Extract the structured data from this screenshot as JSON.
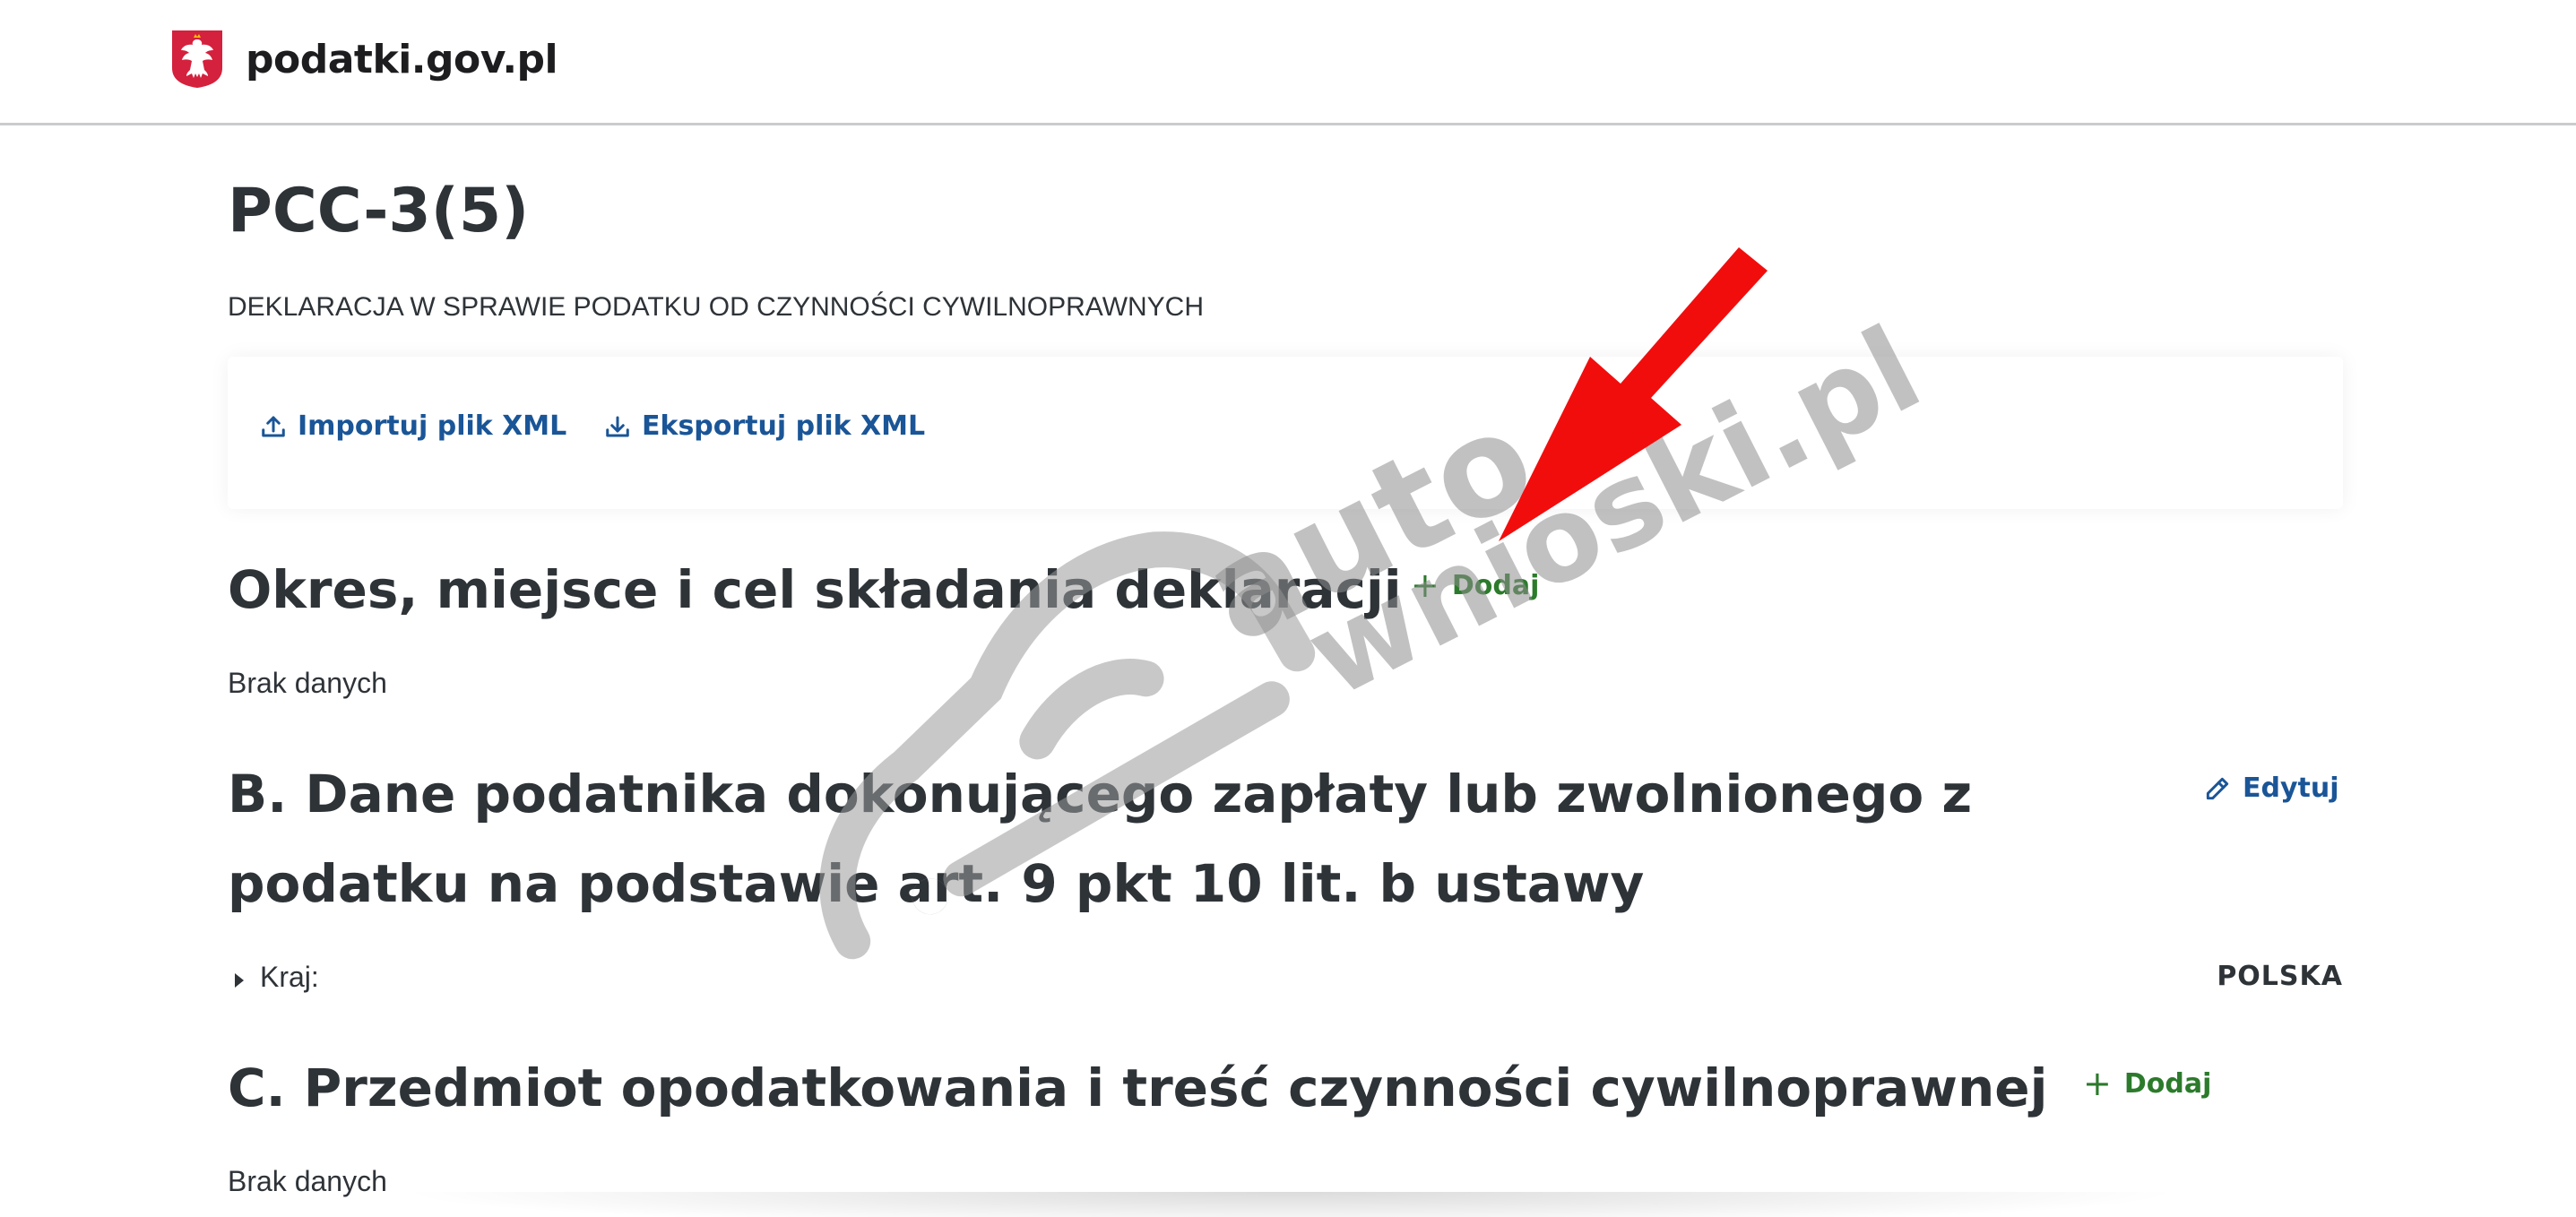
{
  "header": {
    "logo_text": "podatki.gov.pl"
  },
  "page": {
    "title": "PCC-3(5)",
    "subtitle": "DEKLARACJA W SPRAWIE PODATKU OD CZYNNOŚCI CYWILNOPRAWNYCH"
  },
  "toolbar": {
    "import_label": "Importuj plik XML",
    "export_label": "Eksportuj plik XML"
  },
  "sections": [
    {
      "title": "Okres, miejsce i cel składania deklaracji",
      "action_label": "Dodaj",
      "empty_text": "Brak danych"
    },
    {
      "title_line1": "B. Dane podatnika dokonującego zapłaty lub zwolnionego z",
      "title_line2": "podatku na podstawie art. 9 pkt 10 lit. b ustawy",
      "action_label": "Edytuj",
      "fields": [
        {
          "label": "Kraj:",
          "value": "POLSKA"
        }
      ]
    },
    {
      "title": "C. Przedmiot opodatkowania i treść czynności cywilnoprawnej",
      "action_label": "Dodaj",
      "empty_text": "Brak danych"
    }
  ],
  "watermark": {
    "line1": "auto",
    "line2": "wnioski.pl"
  },
  "colors": {
    "link_blue": "#1a5597",
    "add_green": "#2c7a2c",
    "arrow_red": "#f20d0d",
    "text_dark": "#2e3338"
  },
  "icons": {
    "logo": "polish-eagle-emblem-icon",
    "import": "upload-icon",
    "export": "download-icon",
    "add": "plus-icon",
    "edit": "pencil-icon",
    "field_toggle": "caret-right-icon",
    "annotation": "red-arrow-icon"
  }
}
